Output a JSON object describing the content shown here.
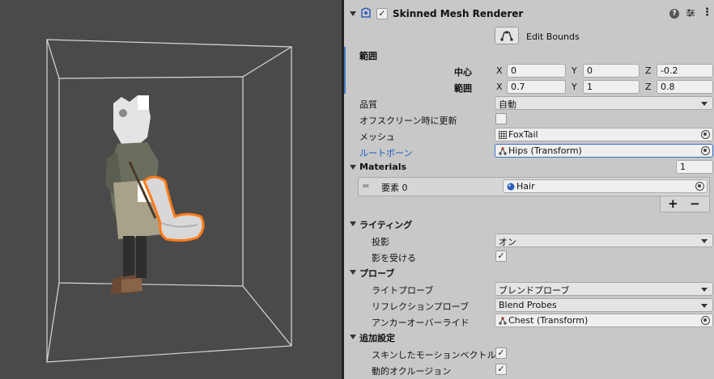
{
  "component": {
    "title": "Skinned Mesh Renderer",
    "enabled_mark": "✓",
    "help_icon": "question-circle-icon",
    "preset_icon": "sliders-icon",
    "menu_icon": "kebab-menu-icon"
  },
  "edit_bounds": {
    "label": "Edit Bounds",
    "icon": "edit-bounds-icon"
  },
  "bounds": {
    "label": "範囲",
    "center": {
      "label": "中心",
      "x": "0",
      "y": "0",
      "z": "-0.2"
    },
    "extent": {
      "label": "範囲",
      "x": "0.7",
      "y": "1",
      "z": "0.8"
    },
    "axis_x": "X",
    "axis_y": "Y",
    "axis_z": "Z"
  },
  "quality": {
    "label": "品質",
    "value": "自動"
  },
  "update_offscreen": {
    "label": "オフスクリーン時に更新",
    "checked": ""
  },
  "mesh": {
    "label": "メッシュ",
    "value": "FoxTail"
  },
  "root_bone": {
    "label": "ルートボーン",
    "value": "Hips (Transform)"
  },
  "materials": {
    "label": "Materials",
    "count": "1",
    "element_label": "要素 0",
    "element_value": "Hair",
    "add_label": "+",
    "remove_label": "−"
  },
  "lighting": {
    "label": "ライティング",
    "cast_shadows": {
      "label": "投影",
      "value": "オン"
    },
    "receive_shadows": {
      "label": "影を受ける",
      "checked": "✓"
    }
  },
  "probes": {
    "label": "プローブ",
    "light_probes": {
      "label": "ライトプローブ",
      "value": "ブレンドプローブ"
    },
    "reflection_probes": {
      "label": "リフレクションプローブ",
      "value": "Blend Probes"
    },
    "anchor_override": {
      "label": "アンカーオーバーライド",
      "value": "Chest (Transform)"
    }
  },
  "additional": {
    "label": "追加設定",
    "skinned_motion_vectors": {
      "label": "スキンしたモーションベクトル",
      "checked": "✓"
    },
    "dynamic_occlusion": {
      "label": "動的オクルージョン",
      "checked": "✓"
    }
  },
  "colors": {
    "selection_outline": "#ff7a1a",
    "scene_bg": "#4a4a4a",
    "link_blue": "#1e5bc6"
  }
}
